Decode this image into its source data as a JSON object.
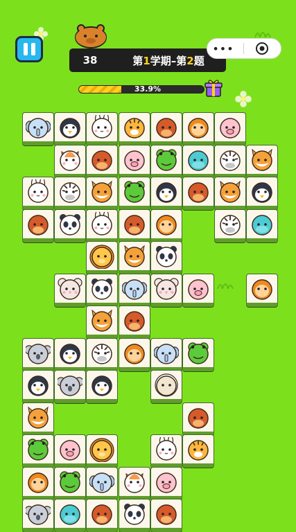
{
  "hud": {
    "score": "38",
    "stage_prefix": "第",
    "term_num": "1",
    "stage_mid": "学期–第",
    "q_num": "2",
    "stage_suffix": "题"
  },
  "progress": {
    "label": "33.9%",
    "value": 0.339
  },
  "capsule": {
    "more": "•••"
  },
  "colors": {
    "background": "#7de01d",
    "tile": "#fcf7ea",
    "tile_edge": "#5f9e2a",
    "highlight": "#ffd21f"
  },
  "tiles": [
    {
      "animal": "elephant",
      "row": 0,
      "col": 0
    },
    {
      "animal": "penguin",
      "row": 0,
      "col": 1
    },
    {
      "animal": "rabbit",
      "row": 0,
      "col": 2
    },
    {
      "animal": "tiger",
      "row": 0,
      "col": 3
    },
    {
      "animal": "cow",
      "row": 0,
      "col": 4
    },
    {
      "animal": "monkey",
      "row": 0,
      "col": 5
    },
    {
      "animal": "pig",
      "row": 0,
      "col": 6
    },
    {
      "animal": "cat",
      "row": 1,
      "col": 1
    },
    {
      "animal": "cow",
      "row": 1,
      "col": 2
    },
    {
      "animal": "pig",
      "row": 1,
      "col": 3
    },
    {
      "animal": "frog",
      "row": 1,
      "col": 4
    },
    {
      "animal": "hippo",
      "row": 1,
      "col": 5
    },
    {
      "animal": "zebra",
      "row": 1,
      "col": 6
    },
    {
      "animal": "fox",
      "row": 1,
      "col": 7
    },
    {
      "animal": "rabbit",
      "row": 2,
      "col": 0
    },
    {
      "animal": "zebra",
      "row": 2,
      "col": 1
    },
    {
      "animal": "fox",
      "row": 2,
      "col": 2
    },
    {
      "animal": "frog",
      "row": 2,
      "col": 3
    },
    {
      "animal": "penguin",
      "row": 2,
      "col": 4
    },
    {
      "animal": "cow",
      "row": 2,
      "col": 5
    },
    {
      "animal": "fox",
      "row": 2,
      "col": 6
    },
    {
      "animal": "penguin",
      "row": 2,
      "col": 7
    },
    {
      "animal": "cow",
      "row": 3,
      "col": 0
    },
    {
      "animal": "panda",
      "row": 3,
      "col": 1
    },
    {
      "animal": "rabbit",
      "row": 3,
      "col": 2
    },
    {
      "animal": "cow",
      "row": 3,
      "col": 3
    },
    {
      "animal": "monkey",
      "row": 3,
      "col": 4
    },
    {
      "animal": "zebra",
      "row": 3,
      "col": 6
    },
    {
      "animal": "hippo",
      "row": 3,
      "col": 7
    },
    {
      "animal": "lion",
      "row": 4,
      "col": 2
    },
    {
      "animal": "fox",
      "row": 4,
      "col": 3
    },
    {
      "animal": "panda",
      "row": 4,
      "col": 4
    },
    {
      "animal": "mouse",
      "row": 5,
      "col": 1
    },
    {
      "animal": "panda",
      "row": 5,
      "col": 2
    },
    {
      "animal": "elephant",
      "row": 5,
      "col": 3
    },
    {
      "animal": "mouse",
      "row": 5,
      "col": 4
    },
    {
      "animal": "pig",
      "row": 5,
      "col": 5
    },
    {
      "animal": "monkey",
      "row": 5,
      "col": 7
    },
    {
      "animal": "fox",
      "row": 6,
      "col": 2
    },
    {
      "animal": "cow",
      "row": 6,
      "col": 3
    },
    {
      "animal": "koala",
      "row": 7,
      "col": 0
    },
    {
      "animal": "penguin",
      "row": 7,
      "col": 1
    },
    {
      "animal": "zebra",
      "row": 7,
      "col": 2
    },
    {
      "animal": "monkey",
      "row": 7,
      "col": 3
    },
    {
      "animal": "elephant",
      "row": 7,
      "col": 4
    },
    {
      "animal": "frog",
      "row": 7,
      "col": 5
    },
    {
      "animal": "penguin",
      "row": 8,
      "col": 0
    },
    {
      "animal": "koala",
      "row": 8,
      "col": 1
    },
    {
      "animal": "penguin",
      "row": 8,
      "col": 2
    },
    {
      "animal": "sheep",
      "row": 8,
      "col": 4
    },
    {
      "animal": "fox",
      "row": 9,
      "col": 0
    },
    {
      "animal": "cow",
      "row": 9,
      "col": 5
    },
    {
      "animal": "frog",
      "row": 10,
      "col": 0
    },
    {
      "animal": "pig",
      "row": 10,
      "col": 1
    },
    {
      "animal": "lion",
      "row": 10,
      "col": 2
    },
    {
      "animal": "rabbit",
      "row": 10,
      "col": 4
    },
    {
      "animal": "tiger",
      "row": 10,
      "col": 5
    },
    {
      "animal": "monkey",
      "row": 11,
      "col": 0
    },
    {
      "animal": "frog",
      "row": 11,
      "col": 1
    },
    {
      "animal": "elephant",
      "row": 11,
      "col": 2
    },
    {
      "animal": "cat",
      "row": 11,
      "col": 3
    },
    {
      "animal": "pig",
      "row": 11,
      "col": 4
    },
    {
      "animal": "koala",
      "row": 12,
      "col": 0
    },
    {
      "animal": "hippo",
      "row": 12,
      "col": 1
    },
    {
      "animal": "cow",
      "row": 12,
      "col": 2
    },
    {
      "animal": "panda",
      "row": 12,
      "col": 3
    },
    {
      "animal": "cow",
      "row": 12,
      "col": 4
    }
  ]
}
